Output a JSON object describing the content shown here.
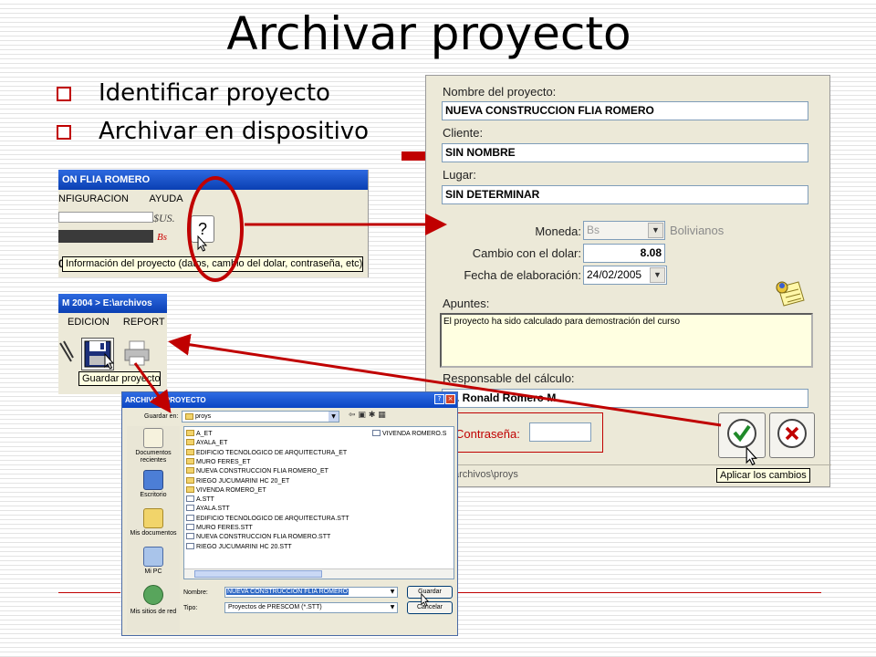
{
  "slide": {
    "title": "Archivar proyecto",
    "bullets": [
      "Identificar proyecto",
      "Archivar en dispositivo"
    ]
  },
  "colors": {
    "accent_red": "#c00000",
    "xp_blue": "#0a3fb3",
    "panel": "#ece9d8",
    "tooltip_bg": "#ffffe1"
  },
  "left_window": {
    "title": "ON FLIA ROMERO",
    "menu": [
      "NFIGURACION",
      "AYUDA"
    ],
    "currency_us": "$US.",
    "currency_bs": "Bs",
    "help_button": "?",
    "tooltip": "Información del proyecto (datos, cambio del dolar, contraseña, etc)",
    "cut_char": "0"
  },
  "left_window2": {
    "title": "M 2004 > E:\\archivos",
    "menu": [
      "EDICION",
      "REPORT"
    ],
    "tooltip": "Guardar proyecto"
  },
  "project": {
    "name_label": "Nombre del proyecto:",
    "name_value": "NUEVA CONSTRUCCION FLIA ROMERO",
    "client_label": "Cliente:",
    "client_value": "SIN NOMBRE",
    "place_label": "Lugar:",
    "place_value": "SIN DETERMINAR",
    "currency_label": "Moneda:",
    "currency_value": "Bs",
    "currency_desc": "Bolivianos",
    "exchange_label": "Cambio con el dolar:",
    "exchange_value": "8.08",
    "date_label": "Fecha de elaboración:",
    "date_value": "24/02/2005",
    "notes_label": "Apuntes:",
    "notes_value": "El proyecto ha sido calculado para demostración del curso",
    "resp_label": "Responsable del cálculo:",
    "resp_value": "rq. Ronald Romero M.",
    "password_label": "Contraseña:",
    "password_value": "",
    "status_path": "archivos\\proys",
    "apply_tooltip": "Aplicar los cambios"
  },
  "save_dialog": {
    "title": "ARCHIVAR PROYECTO",
    "save_in_label": "Guardar en:",
    "save_in_value": "proys",
    "places": [
      "Documentos recientes",
      "Escritorio",
      "Mis documentos",
      "Mi PC",
      "Mis sitios de red"
    ],
    "files_col1": [
      {
        "name": "A_ET",
        "type": "folder"
      },
      {
        "name": "AYALA_ET",
        "type": "folder"
      },
      {
        "name": "EDIFICIO TECNOLOGICO DE ARQUITECTURA_ET",
        "type": "folder"
      },
      {
        "name": "MURO FERES_ET",
        "type": "folder"
      },
      {
        "name": "NUEVA CONSTRUCCION FLIA ROMERO_ET",
        "type": "folder"
      },
      {
        "name": "RIEGO JUCUMARINI HC 20_ET",
        "type": "folder"
      },
      {
        "name": "VIVENDA ROMERO_ET",
        "type": "folder"
      },
      {
        "name": "A.STT",
        "type": "file"
      },
      {
        "name": "AYALA.STT",
        "type": "file"
      },
      {
        "name": "EDIFICIO TECNOLOGICO DE ARQUITECTURA.STT",
        "type": "file"
      },
      {
        "name": "MURO FERES.STT",
        "type": "file"
      },
      {
        "name": "NUEVA CONSTRUCCION FLIA ROMERO.STT",
        "type": "file"
      },
      {
        "name": "RIEGO JUCUMARINI HC 20.STT",
        "type": "file"
      }
    ],
    "files_col2": [
      {
        "name": "VIVENDA ROMERO.S",
        "type": "file"
      }
    ],
    "name_label": "Nombre:",
    "name_value": "NUEVA CONSTRUCCION FLIA ROMERO",
    "type_label": "Tipo:",
    "type_value": "Proyectos de PRESCOM (*.STT)",
    "save_button": "Guardar",
    "cancel_button": "Cancelar"
  }
}
